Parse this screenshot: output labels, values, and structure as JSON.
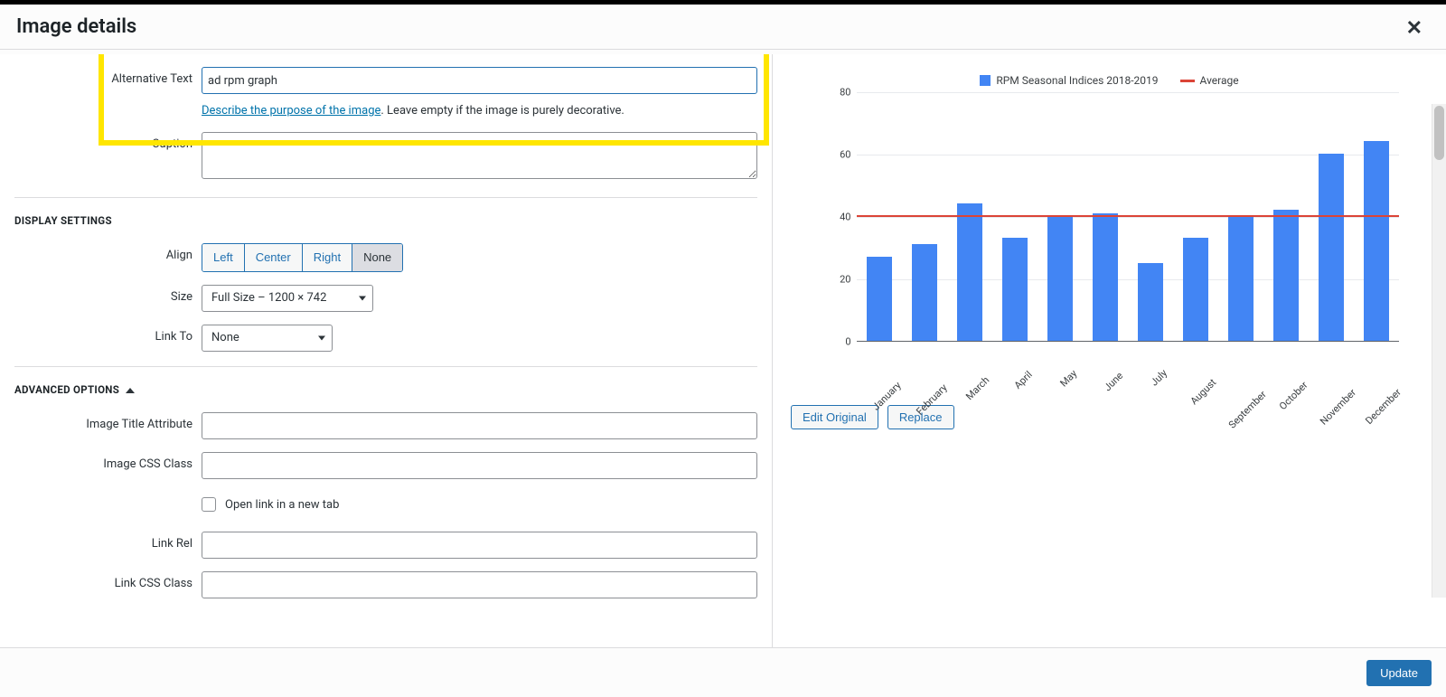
{
  "modal": {
    "title": "Image details",
    "close_glyph": "✕"
  },
  "form": {
    "alt_label": "Alternative Text",
    "alt_value": "ad rpm graph",
    "alt_help_link": "Describe the purpose of the image",
    "alt_help_rest": ". Leave empty if the image is purely decorative.",
    "caption_label": "Caption",
    "caption_value": ""
  },
  "display": {
    "heading": "DISPLAY SETTINGS",
    "align_label": "Align",
    "align_options": [
      "Left",
      "Center",
      "Right",
      "None"
    ],
    "align_selected_index": 3,
    "size_label": "Size",
    "size_value": "Full Size – 1200 × 742",
    "linkto_label": "Link To",
    "linkto_value": "None"
  },
  "advanced": {
    "heading": "ADVANCED OPTIONS",
    "title_attr_label": "Image Title Attribute",
    "title_attr_value": "",
    "css_class_label": "Image CSS Class",
    "css_class_value": "",
    "newtab_label": "Open link in a new tab",
    "link_rel_label": "Link Rel",
    "link_rel_value": "",
    "link_css_label": "Link CSS Class",
    "link_css_value": ""
  },
  "preview": {
    "edit_original_label": "Edit Original",
    "replace_label": "Replace"
  },
  "footer": {
    "update_label": "Update"
  },
  "chart_data": {
    "type": "bar",
    "categories": [
      "January",
      "February",
      "March",
      "April",
      "May",
      "June",
      "July",
      "August",
      "September",
      "October",
      "November",
      "December"
    ],
    "series": [
      {
        "name": "RPM Seasonal Indices 2018-2019",
        "values": [
          27,
          31,
          44,
          33,
          40,
          41,
          25,
          33,
          40,
          42,
          60,
          64
        ]
      }
    ],
    "average": {
      "name": "Average",
      "value": 40
    },
    "ylim": [
      0,
      80
    ],
    "yticks": [
      0,
      20,
      40,
      60,
      80
    ],
    "title": "",
    "xlabel": "",
    "ylabel": "",
    "legend": [
      "RPM Seasonal Indices 2018-2019",
      "Average"
    ]
  }
}
